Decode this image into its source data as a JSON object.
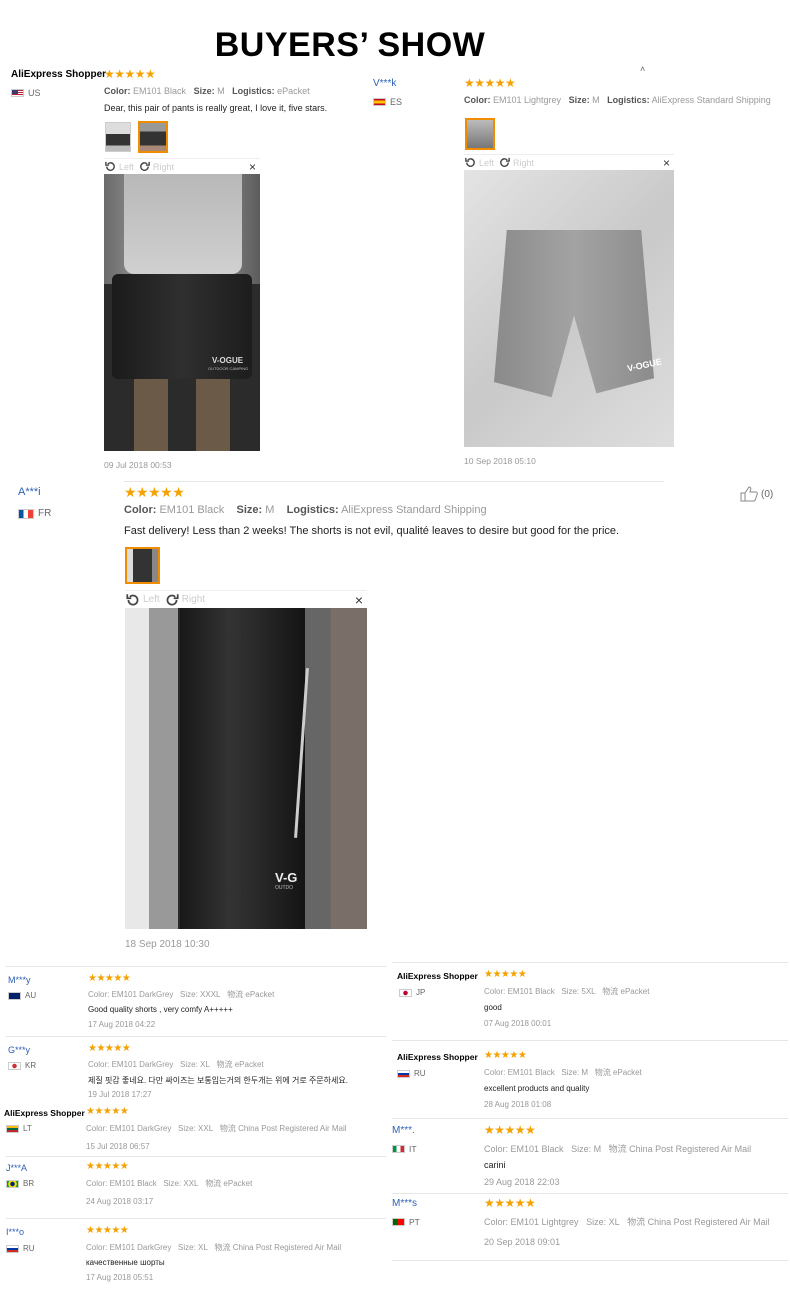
{
  "header": {
    "title": "BUYERS’ SHOW",
    "caret": "˄"
  },
  "stars": "★★★★★",
  "reviews_top": [
    {
      "name": "AliExpress Shopper",
      "country": "US",
      "color_label": "Color:",
      "color": "EM101 Black",
      "size_label": "Size:",
      "size": "M",
      "logistics_label": "Logistics:",
      "logistics": "ePacket",
      "text": "Dear, this pair of pants is really great, I love it, five stars.",
      "date": "09 Jul 2018 00:53"
    },
    {
      "name": "V***k",
      "country": "ES",
      "color_label": "Color:",
      "color": "EM101 Lightgrey",
      "size_label": "Size:",
      "size": "M",
      "logistics_label": "Logistics:",
      "logistics": "AliExpress Standard Shipping",
      "date": "10 Sep 2018 05:10"
    }
  ],
  "review_mid": {
    "name": "A***i",
    "country": "FR",
    "color_label": "Color:",
    "color": "EM101 Black",
    "size_label": "Size:",
    "size": "M",
    "logistics_label": "Logistics:",
    "logistics": "AliExpress Standard Shipping",
    "text": "Fast delivery! Less than 2 weeks! The shorts is not evil, qualité leaves to desire but good for the price.",
    "date": "18 Sep 2018 10:30",
    "likes": "(0)"
  },
  "viewer": {
    "left": "Left",
    "right": "Right",
    "close": "×"
  },
  "photo_brand": {
    "p1": "V-OGUE",
    "p1sub": "OUTDOOR CAMPING",
    "p2": "V-OGUE",
    "p3": "V-G",
    "p3sub": "OUTDO"
  },
  "reviews_left": [
    {
      "name": "M***y",
      "country": "AU",
      "color": "Color: EM101 DarkGrey",
      "size": "Size: XXXL",
      "logistics": "物流 ePacket",
      "text": "Good quality shorts , very comfy A+++++",
      "date": "17 Aug 2018 04:22"
    },
    {
      "name": "G***y",
      "country": "KR",
      "color": "Color: EM101 DarkGrey",
      "size": "Size: XL",
      "logistics": "物流 ePacket",
      "text": "제질 핏감 좋네요. 다만 싸이즈는 보통입는거의 한두개는 위에 거로 주문하세요.",
      "date": "19 Jul 2018 17:27"
    },
    {
      "name": "AliExpress Shopper",
      "country": "LT",
      "color": "Color: EM101 DarkGrey",
      "size": "Size: XXL",
      "logistics": "物流 China Post Registered Air Mail",
      "text": "",
      "date": "15 Jul 2018 06:57"
    },
    {
      "name": "J***A",
      "country": "BR",
      "color": "Color: EM101 Black",
      "size": "Size: XXL",
      "logistics": "物流 ePacket",
      "text": "",
      "date": "24 Aug 2018 03:17"
    },
    {
      "name": "I***o",
      "country": "RU",
      "color": "Color: EM101 DarkGrey",
      "size": "Size: XL",
      "logistics": "物流 China Post Registered Air Mail",
      "text": "качественные шорты",
      "date": "17 Aug 2018 05:51"
    }
  ],
  "reviews_right": [
    {
      "name": "AliExpress Shopper",
      "country": "JP",
      "color": "Color: EM101 Black",
      "size": "Size: 5XL",
      "logistics": "物流 ePacket",
      "text": "good",
      "date": "07 Aug 2018 00:01"
    },
    {
      "name": "AliExpress Shopper",
      "country": "RU",
      "color": "Color: EM101 Black",
      "size": "Size: M",
      "logistics": "物流 ePacket",
      "text": "excellent products and quality",
      "date": "28 Aug 2018 01:08"
    },
    {
      "name": "M***.",
      "country": "IT",
      "color": "Color: EM101 Black",
      "size": "Size: M",
      "logistics": "物流 China Post Registered Air Mail",
      "text": "carini",
      "date": "29 Aug 2018 22:03"
    },
    {
      "name": "M***s",
      "country": "PT",
      "color": "Color: EM101 Lightgrey",
      "size": "Size: XL",
      "logistics": "物流 China Post Registered Air Mail",
      "text": "",
      "date": "20 Sep 2018 09:01"
    }
  ]
}
